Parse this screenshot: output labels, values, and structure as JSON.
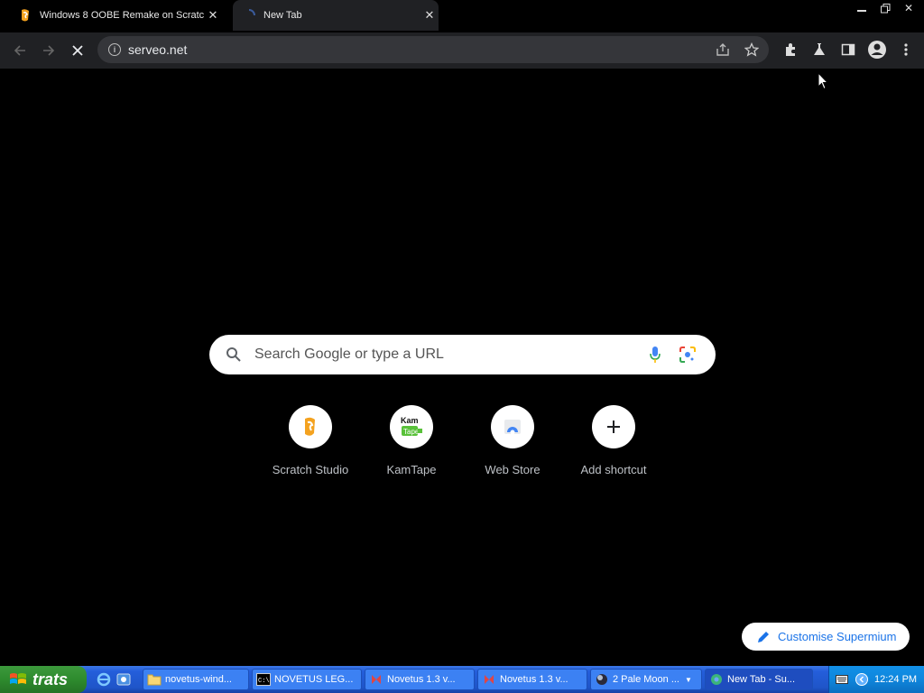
{
  "tabs": [
    {
      "title": "Windows 8 OOBE Remake on Scratc",
      "active": false
    },
    {
      "title": "New Tab",
      "active": true
    }
  ],
  "toolbar": {
    "url": "serveo.net"
  },
  "search": {
    "placeholder": "Search Google or type a URL"
  },
  "shortcuts": [
    {
      "label": "Scratch Studio",
      "icon": "scratch-icon"
    },
    {
      "label": "KamTape",
      "icon": "kamtape-icon"
    },
    {
      "label": "Web Store",
      "icon": "web-store-icon"
    },
    {
      "label": "Add shortcut",
      "icon": "plus-icon"
    }
  ],
  "customise": {
    "label": "Customise Supermium"
  },
  "taskbar": {
    "start_label": "trats",
    "tasks": [
      {
        "label": "novetus-wind...",
        "icon": "folder-icon"
      },
      {
        "label": "NOVETUS LEG...",
        "icon": "console-icon"
      },
      {
        "label": "Novetus 1.3 v...",
        "icon": "novetus-icon"
      },
      {
        "label": "Novetus 1.3 v...",
        "icon": "novetus-icon"
      },
      {
        "label": "2 Pale Moon ...",
        "icon": "pale-moon-icon"
      },
      {
        "label": "New Tab - Su...",
        "icon": "supermium-icon"
      }
    ],
    "clock": "12:24 PM"
  },
  "colors": {
    "accent": "#1a73e8",
    "taskbar": "#245edb",
    "start": "#2e8b2e"
  }
}
